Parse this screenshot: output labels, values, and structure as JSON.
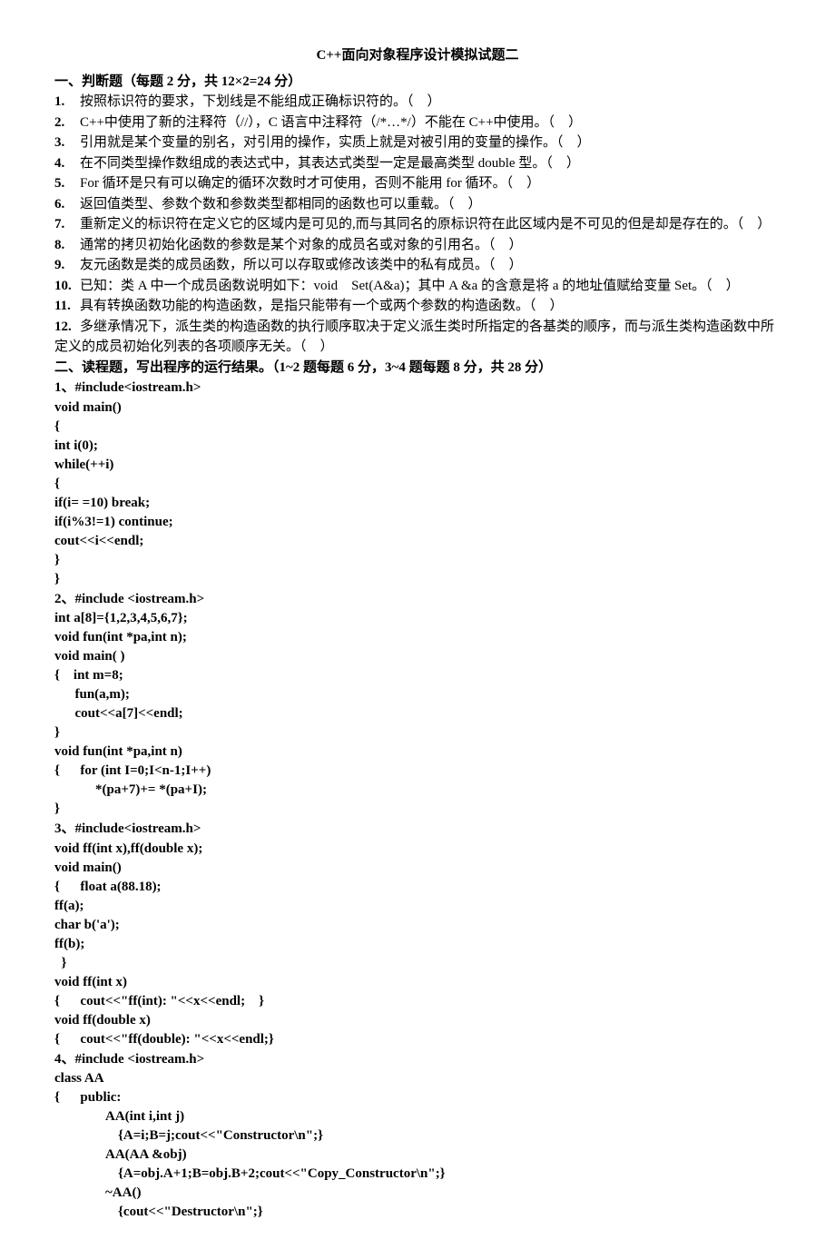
{
  "title": "C++面向对象程序设计模拟试题二",
  "section1": {
    "header": "一、判断题（每题 2 分，共 12×2=24 分）",
    "items": [
      {
        "n": "1.",
        "t": "按照标识符的要求，下划线是不能组成正确标识符的。（　）"
      },
      {
        "n": "2.",
        "t": "C++中使用了新的注释符（//），C 语言中注释符（/*…*/）不能在 C++中使用。（　）"
      },
      {
        "n": "3.",
        "t": "引用就是某个变量的别名，对引用的操作，实质上就是对被引用的变量的操作。（　）"
      },
      {
        "n": "4.",
        "t": "在不同类型操作数组成的表达式中，其表达式类型一定是最高类型 double 型。（　）"
      },
      {
        "n": "5.",
        "t": "For 循环是只有可以确定的循环次数时才可使用，否则不能用 for 循环。（　）"
      },
      {
        "n": "6.",
        "t": "返回值类型、参数个数和参数类型都相同的函数也可以重载。（　）"
      },
      {
        "n": "7.",
        "t": "重新定义的标识符在定义它的区域内是可见的,而与其同名的原标识符在此区域内是不可见的但是却是存在的。（　）"
      },
      {
        "n": "8.",
        "t": "通常的拷贝初始化函数的参数是某个对象的成员名或对象的引用名。（　）"
      },
      {
        "n": "9.",
        "t": "友元函数是类的成员函数，所以可以存取或修改该类中的私有成员。（　）"
      },
      {
        "n": "10.",
        "t": "已知：类 A 中一个成员函数说明如下：void　Set(A&a)；其中 A &a 的含意是将 a 的地址值赋给变量 Set。（　）"
      },
      {
        "n": "11.",
        "t": "具有转换函数功能的构造函数，是指只能带有一个或两个参数的构造函数。（　）"
      },
      {
        "n": "12.",
        "t": "多继承情况下，派生类的构造函数的执行顺序取决于定义派生类时所指定的各基类的顺序，而与派生类构造函数中所定义的成员初始化列表的各项顺序无关。（　）"
      }
    ]
  },
  "section2": {
    "header": "二、读程题，写出程序的运行结果。（1~2 题每题 6 分，3~4 题每题 8 分，共 28 分）",
    "q1label": "1、#include<iostream.h>",
    "q1code": "void main()\n{\nint i(0);\nwhile(++i)\n{\nif(i= =10) break;\nif(i%3!=1) continue;\ncout<<i<<endl;\n}\n}",
    "q2label": "2、#include <iostream.h>",
    "q2code": "int a[8]={1,2,3,4,5,6,7};\nvoid fun(int *pa,int n);\nvoid main( )\n{    int m=8;\n      fun(a,m);\n      cout<<a[7]<<endl;\n}\nvoid fun(int *pa,int n)\n{      for (int I=0;I<n-1;I++)\n            *(pa+7)+= *(pa+I);\n}",
    "q3label": "3、#include<iostream.h>",
    "q3code": "void ff(int x),ff(double x);\nvoid main()\n{      float a(88.18);\nff(a);\nchar b('a');\nff(b);\n  }\nvoid ff(int x)\n{      cout<<\"ff(int): \"<<x<<endl;    }\nvoid ff(double x)\n{      cout<<\"ff(double): \"<<x<<endl;}",
    "q4label": "4、#include <iostream.h>",
    "q4lines": [
      {
        "cls": "",
        "t": "class AA"
      },
      {
        "cls": "",
        "t": "{      public:"
      },
      {
        "cls": "indent2",
        "t": "AA(int i,int j)"
      },
      {
        "cls": "indent3",
        "t": "{A=i;B=j;cout<<\"Constructor\\n\";}"
      },
      {
        "cls": "indent2",
        "t": "AA(AA &obj)"
      },
      {
        "cls": "indent3",
        "t": "{A=obj.A+1;B=obj.B+2;cout<<\"Copy_Constructor\\n\";}"
      },
      {
        "cls": "indent2",
        "t": "~AA()"
      },
      {
        "cls": "indent3",
        "t": "{cout<<\"Destructor\\n\";}"
      }
    ]
  }
}
